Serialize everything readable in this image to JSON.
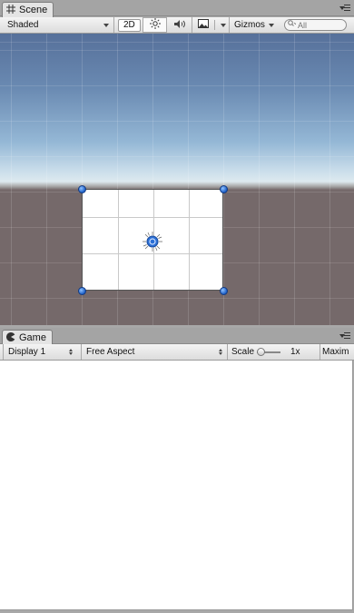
{
  "scene_tab": {
    "label": "Scene",
    "icon": "hash-grid-icon"
  },
  "scene_toolbar": {
    "draw_mode": "Shaded",
    "mode_2d": "2D",
    "lighting_icon": "sun-icon",
    "audio_icon": "speaker-icon",
    "effects_icon": "image-icon",
    "gizmos": "Gizmos",
    "search_placeholder": "All"
  },
  "game_tab": {
    "label": "Game",
    "icon": "pacman-icon"
  },
  "game_toolbar": {
    "display": "Display 1",
    "aspect": "Free Aspect",
    "scale_label": "Scale",
    "scale_value": "1x",
    "maximize": "Maxim"
  },
  "colors": {
    "handle": "#2a6fd6",
    "ground": "#75696a",
    "sky_top": "#56709a"
  }
}
